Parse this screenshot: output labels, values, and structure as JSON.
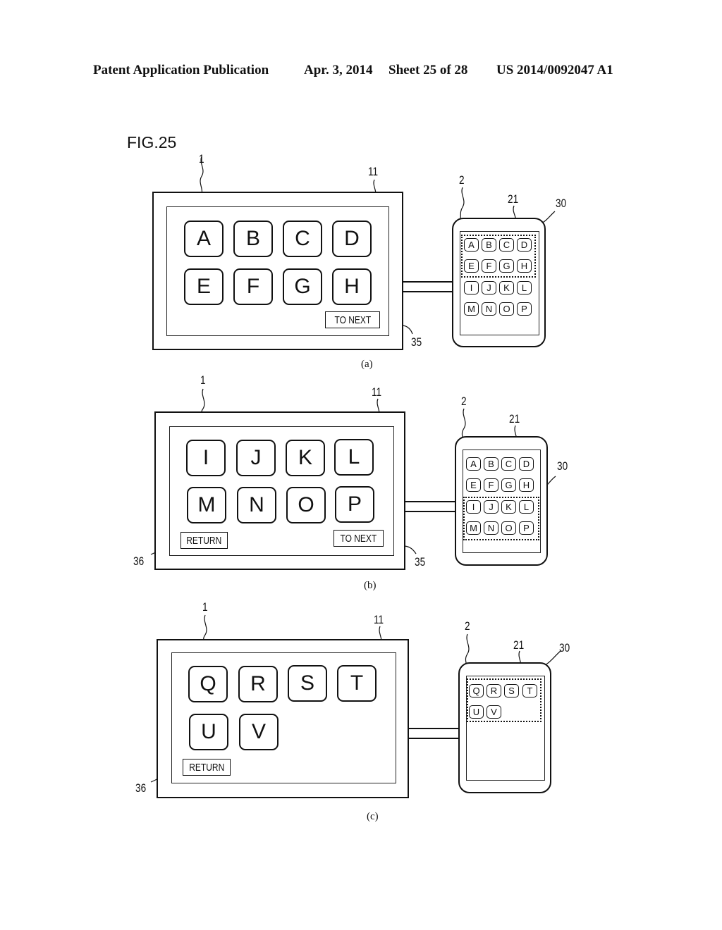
{
  "header": {
    "publication": "Patent Application Publication",
    "date": "Apr. 3, 2014",
    "sheet": "Sheet 25 of 28",
    "number": "US 2014/0092047 A1"
  },
  "figure": {
    "title": "FIG.25",
    "ref_labels": {
      "display_device": "1",
      "display_screen": "11",
      "portable_terminal": "2",
      "terminal_screen": "21",
      "display_area_frame": "30",
      "to_next_button": "35",
      "return_button": "36"
    },
    "button_labels": {
      "to_next": "TO NEXT",
      "return": "RETURN"
    },
    "panels": [
      {
        "caption": "(a)",
        "main_keys": [
          "A",
          "B",
          "C",
          "D",
          "E",
          "F",
          "G",
          "H"
        ],
        "has_return": false,
        "has_to_next": true,
        "terminal_keys": [
          "A",
          "B",
          "C",
          "D",
          "E",
          "F",
          "G",
          "H",
          "I",
          "J",
          "K",
          "L",
          "M",
          "N",
          "O",
          "P"
        ],
        "highlighted_rows": "A-H"
      },
      {
        "caption": "(b)",
        "main_keys": [
          "I",
          "J",
          "K",
          "L",
          "M",
          "N",
          "O",
          "P"
        ],
        "has_return": true,
        "has_to_next": true,
        "terminal_keys": [
          "A",
          "B",
          "C",
          "D",
          "E",
          "F",
          "G",
          "H",
          "I",
          "J",
          "K",
          "L",
          "M",
          "N",
          "O",
          "P"
        ],
        "highlighted_rows": "I-P"
      },
      {
        "caption": "(c)",
        "main_keys": [
          "Q",
          "R",
          "S",
          "T",
          "U",
          "V"
        ],
        "has_return": true,
        "has_to_next": false,
        "terminal_keys": [
          "Q",
          "R",
          "S",
          "T",
          "U",
          "V"
        ],
        "highlighted_rows": "Q-V"
      }
    ]
  }
}
